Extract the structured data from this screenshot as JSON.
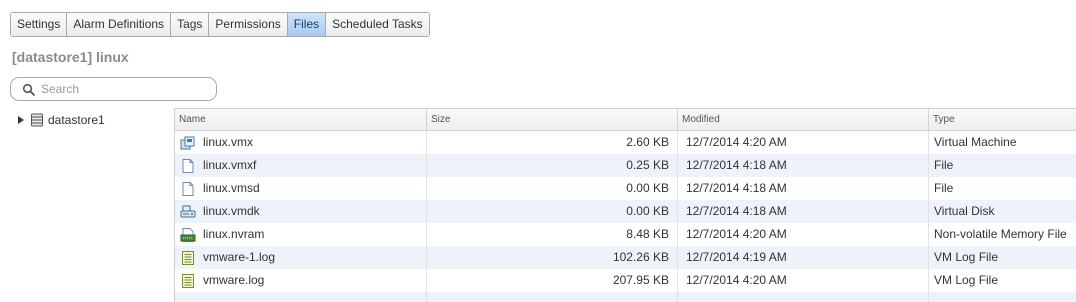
{
  "tabs": [
    {
      "label": "Settings",
      "active": false
    },
    {
      "label": "Alarm Definitions",
      "active": false
    },
    {
      "label": "Tags",
      "active": false
    },
    {
      "label": "Permissions",
      "active": false
    },
    {
      "label": "Files",
      "active": true
    },
    {
      "label": "Scheduled Tasks",
      "active": false
    }
  ],
  "page_title": "[datastore1] linux",
  "search": {
    "placeholder": "Search",
    "value": ""
  },
  "tree": {
    "root_label": "datastore1",
    "expanded": false,
    "icon": "datastore-icon"
  },
  "grid": {
    "columns": {
      "name": "Name",
      "size": "Size",
      "modified": "Modified",
      "type": "Type"
    },
    "rows": [
      {
        "name": "linux.vmx",
        "size": "2.60 KB",
        "modified": "12/7/2014 4:20 AM",
        "type": "Virtual Machine",
        "icon": "virtual-machine-icon"
      },
      {
        "name": "linux.vmxf",
        "size": "0.25 KB",
        "modified": "12/7/2014 4:18 AM",
        "type": "File",
        "icon": "file-icon"
      },
      {
        "name": "linux.vmsd",
        "size": "0.00 KB",
        "modified": "12/7/2014 4:18 AM",
        "type": "File",
        "icon": "file-icon"
      },
      {
        "name": "linux.vmdk",
        "size": "0.00 KB",
        "modified": "12/7/2014 4:18 AM",
        "type": "Virtual Disk",
        "icon": "virtual-disk-icon"
      },
      {
        "name": "linux.nvram",
        "size": "8.48 KB",
        "modified": "12/7/2014 4:20 AM",
        "type": "Non-volatile Memory File",
        "icon": "nvram-icon"
      },
      {
        "name": "vmware-1.log",
        "size": "102.26 KB",
        "modified": "12/7/2014 4:19 AM",
        "type": "VM Log File",
        "icon": "log-file-icon"
      },
      {
        "name": "vmware.log",
        "size": "207.95 KB",
        "modified": "12/7/2014 4:20 AM",
        "type": "VM Log File",
        "icon": "log-file-icon"
      }
    ]
  },
  "colors": {
    "active_tab": "#a9c9f2",
    "row_alt": "#eef3fa",
    "title": "#8a8a8a"
  }
}
